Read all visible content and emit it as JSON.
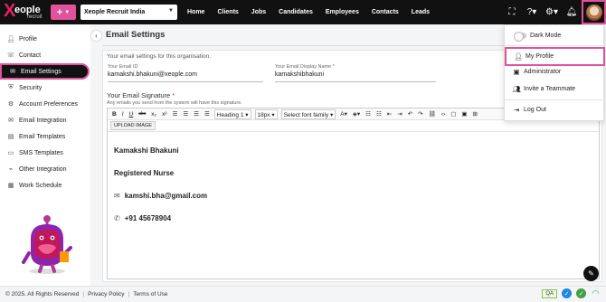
{
  "brand": {
    "logo_x": "X",
    "logo_name": "eople",
    "logo_sub": "recruit"
  },
  "header": {
    "plus_label": "+",
    "org": "Xeople Recruit India",
    "nav": [
      "Home",
      "Clients",
      "Jobs",
      "Candidates",
      "Employees",
      "Contacts",
      "Leads"
    ]
  },
  "sidebar": {
    "items": [
      {
        "label": "Profile",
        "icon": "person-icon"
      },
      {
        "label": "Contact",
        "icon": "contact-icon"
      },
      {
        "label": "Email Settings",
        "icon": "mail-icon"
      },
      {
        "label": "Security",
        "icon": "shield-icon"
      },
      {
        "label": "Account Preferences",
        "icon": "user-gear-icon"
      },
      {
        "label": "Email Integration",
        "icon": "mail-sync-icon"
      },
      {
        "label": "Email Templates",
        "icon": "template-icon"
      },
      {
        "label": "SMS Templates",
        "icon": "sms-icon"
      },
      {
        "label": "Other Integration",
        "icon": "plug-icon"
      },
      {
        "label": "Work Schedule",
        "icon": "schedule-icon"
      }
    ]
  },
  "main": {
    "title": "Email Settings",
    "description": "Your email settings for this organisation.",
    "email_id_label": "Your Email ID",
    "email_id_value": "kamakshi.bhakuni@xeople.com",
    "display_name_label": "Your Email Display Name *",
    "display_name_value": "kamakshibhakuni",
    "signature_label": "Your Email Signature",
    "signature_required": "*",
    "signature_hint": "Any emails you send from the system will have this signature.",
    "toolbar": {
      "bold": "B",
      "italic": "I",
      "underline": "U",
      "strike": "abc",
      "sub": "x₂",
      "sup": "x²",
      "heading": "Heading 1",
      "size": "18px",
      "font": "Select font family"
    },
    "upload_image": "UPLOAD IMAGE",
    "signature": {
      "name": "Kamakshi Bhakuni",
      "role": "Registered Nurse",
      "email": "kamshi.bha@gmail.com",
      "phone": "+91 45678904"
    }
  },
  "dropdown": {
    "items": [
      "Dark Mode",
      "My Profile",
      "Administrator",
      "Invite a Teammate",
      "Log Out"
    ]
  },
  "footer": {
    "copyright": "© 2025. All Rights Reserved",
    "privacy": "Privacy Policy",
    "terms": "Terms of Use",
    "qa": "QA"
  },
  "colors": {
    "accent": "#e0529c",
    "topbar": "#111111"
  }
}
